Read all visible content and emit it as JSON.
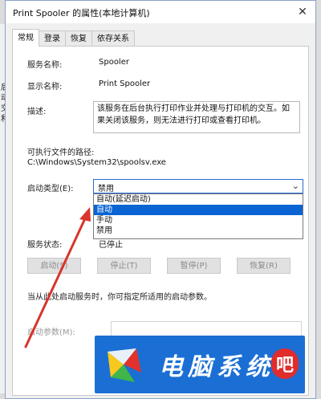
{
  "background": {
    "left_text": [
      "后",
      "动",
      "交",
      "和"
    ]
  },
  "dialog": {
    "title": "Print Spooler 的属性(本地计算机)",
    "tabs": [
      {
        "label": "常规",
        "active": true
      },
      {
        "label": "登录",
        "active": false
      },
      {
        "label": "恢复",
        "active": false
      },
      {
        "label": "依存关系",
        "active": false
      }
    ],
    "fields": {
      "service_name_label": "服务名称:",
      "service_name": "Spooler",
      "display_name_label": "显示名称:",
      "display_name": "Print Spooler",
      "description_label": "描述:",
      "description": "该服务在后台执行打印作业并处理与打印机的交互。如果关闭该服务，则无法进行打印或查看打印机。",
      "path_label": "可执行文件的路径:",
      "path": "C:\\Windows\\System32\\spoolsv.exe",
      "startup_type_label": "启动类型(E):",
      "startup_type_selected": "禁用",
      "startup_options": [
        "自动(延迟启动)",
        "自动",
        "手动",
        "禁用"
      ],
      "highlighted_option_index": 1,
      "service_status_label": "服务状态:",
      "service_status": "已停止"
    },
    "buttons": {
      "start": "启动(S)",
      "stop": "停止(T)",
      "pause": "暂停(P)",
      "resume": "恢复(R)"
    },
    "hint_text": "当从此处启动服务时，你可指定所适用的启动参数。",
    "start_params_label": "启动参数(M):"
  },
  "watermark": {
    "text": "电脑系统",
    "badge": "吧"
  },
  "colors": {
    "accent": "#0a64d4",
    "arrow": "#d9342b",
    "watermark_bg": "#1b6fd4"
  }
}
